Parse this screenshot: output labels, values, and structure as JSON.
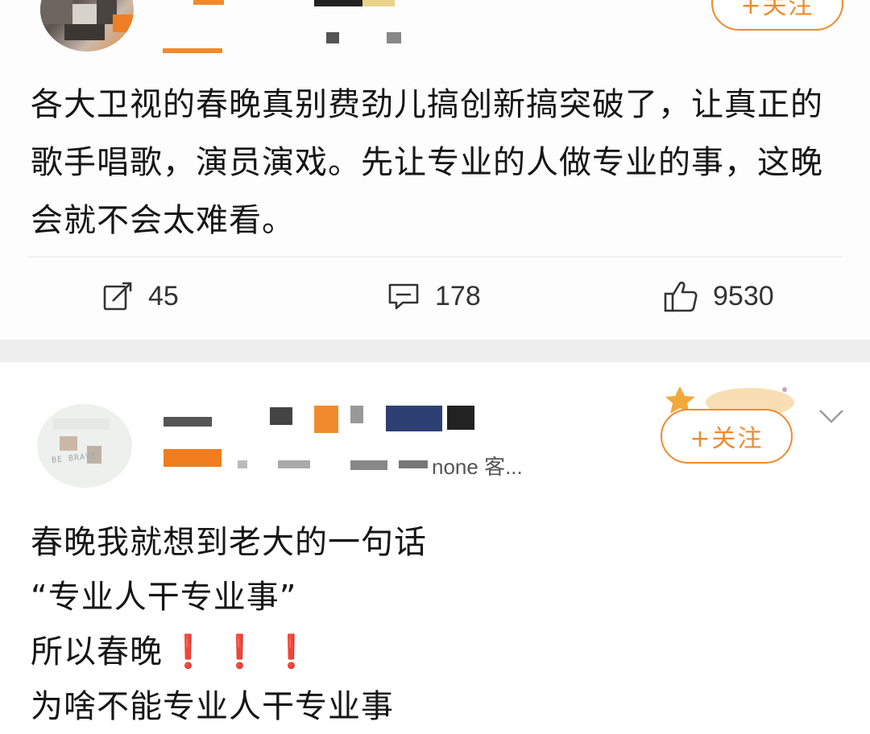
{
  "posts": [
    {
      "follow_label": "+关注",
      "text": "各大卫视的春晚真别费劲儿搞创新搞突破了，让真正的歌手唱歌，演员演戏。先让专业的人做专业的事，这晚会就不会太难看。",
      "actions": {
        "repost_count": "45",
        "comment_count": "178",
        "like_count": "9530"
      }
    },
    {
      "follow_label": "+关注",
      "meta_visible": "none 客...",
      "avatar_brand_text": "BE BRAVE",
      "lines": [
        "春晚我就想到老大的一句话",
        "“专业人干专业事”",
        "所以春晚",
        "为啥不能专业人干专业事"
      ],
      "exclamations": [
        "❗",
        "❗",
        "❗"
      ]
    }
  ],
  "colors": {
    "accent": "#f08a2c",
    "exclamation": "#e21b1b",
    "separator": "#eeeeee",
    "text": "#161616"
  },
  "icons": {
    "repost": "repost-icon",
    "comment": "comment-icon",
    "like": "like-icon",
    "more": "chevron-down-icon"
  }
}
